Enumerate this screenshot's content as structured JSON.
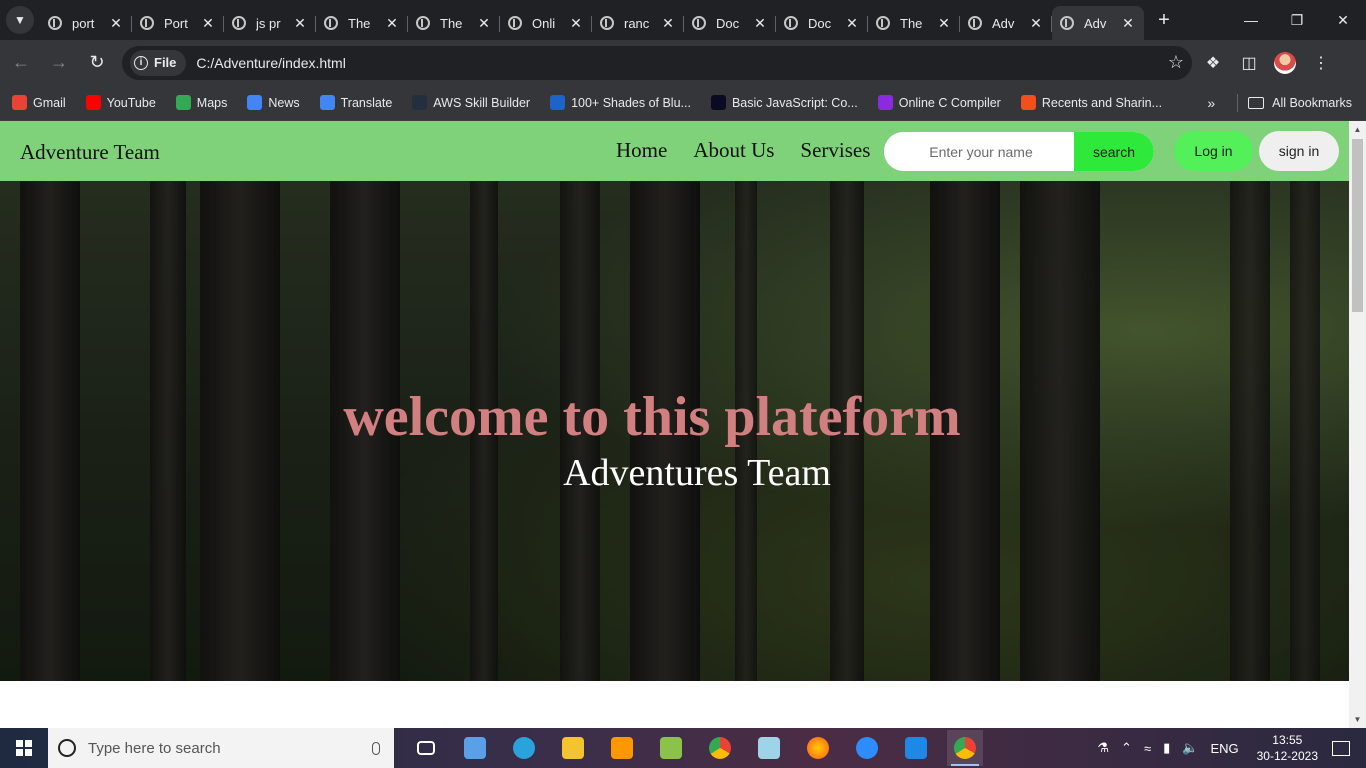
{
  "browser": {
    "tabs": [
      {
        "title": "port",
        "active": false
      },
      {
        "title": "Port",
        "active": false
      },
      {
        "title": "js pr",
        "active": false
      },
      {
        "title": "The",
        "active": false
      },
      {
        "title": "The",
        "active": false
      },
      {
        "title": "Onli",
        "active": false
      },
      {
        "title": "ranc",
        "active": false
      },
      {
        "title": "Doc",
        "active": false
      },
      {
        "title": "Doc",
        "active": false
      },
      {
        "title": "The",
        "active": false
      },
      {
        "title": "Adv",
        "active": false
      },
      {
        "title": "Adv",
        "active": true
      }
    ],
    "address": {
      "chip_label": "File",
      "url": "C:/Adventure/index.html"
    },
    "bookmarks": [
      {
        "label": "Gmail",
        "color": "#ea4335"
      },
      {
        "label": "YouTube",
        "color": "#ff0000"
      },
      {
        "label": "Maps",
        "color": "#34a853"
      },
      {
        "label": "News",
        "color": "#4285f4"
      },
      {
        "label": "Translate",
        "color": "#4285f4"
      },
      {
        "label": "AWS Skill Builder",
        "color": "#232f3e"
      },
      {
        "label": "100+ Shades of Blu...",
        "color": "#1e63c8"
      },
      {
        "label": "Basic JavaScript: Co...",
        "color": "#0a0a23"
      },
      {
        "label": "Online C Compiler",
        "color": "#8a2be2"
      },
      {
        "label": "Recents and Sharin...",
        "color": "#f24e1e"
      }
    ],
    "all_bookmarks_label": "All Bookmarks"
  },
  "site": {
    "brand": "Adventure Team",
    "nav_links": [
      "Home",
      "About Us",
      "Servises"
    ],
    "search_placeholder": "Enter your name",
    "search_button": "search",
    "login_button": "Log in",
    "signin_button": "sign in",
    "hero_title": "welcome to this plateform",
    "hero_subtitle": "Adventures Team",
    "title_color": "#d17f80",
    "nav_color": "#7fd17a"
  },
  "taskbar": {
    "search_placeholder": "Type here to search",
    "language": "ENG",
    "time": "13:55",
    "date": "30-12-2023"
  }
}
